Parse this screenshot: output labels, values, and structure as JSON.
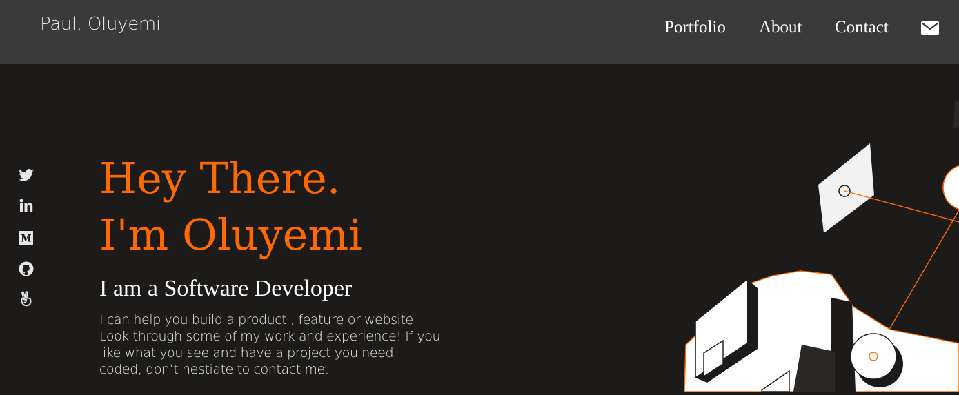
{
  "header": {
    "brand": "Paul, Oluyemi",
    "nav": [
      {
        "label": "Portfolio"
      },
      {
        "label": "About"
      },
      {
        "label": "Contact"
      }
    ],
    "mail_icon": "envelope-icon"
  },
  "socials": [
    {
      "icon": "twitter-icon"
    },
    {
      "icon": "linkedin-icon"
    },
    {
      "icon": "medium-icon"
    },
    {
      "icon": "github-icon"
    },
    {
      "icon": "angellist-icon"
    }
  ],
  "hero": {
    "line1": "Hey There.",
    "line2": "I'm Oluyemi",
    "role": "I am a Software Developer",
    "description": [
      "I can help you build a product , feature or website",
      "Look through some of my work and experience! If you",
      "like what you see and have a project you need",
      "coded, don’t hestiate to contact me."
    ]
  },
  "colors": {
    "accent": "#ff6a00",
    "header_bg": "#3a3a3a",
    "page_bg": "#1c1b1a"
  }
}
